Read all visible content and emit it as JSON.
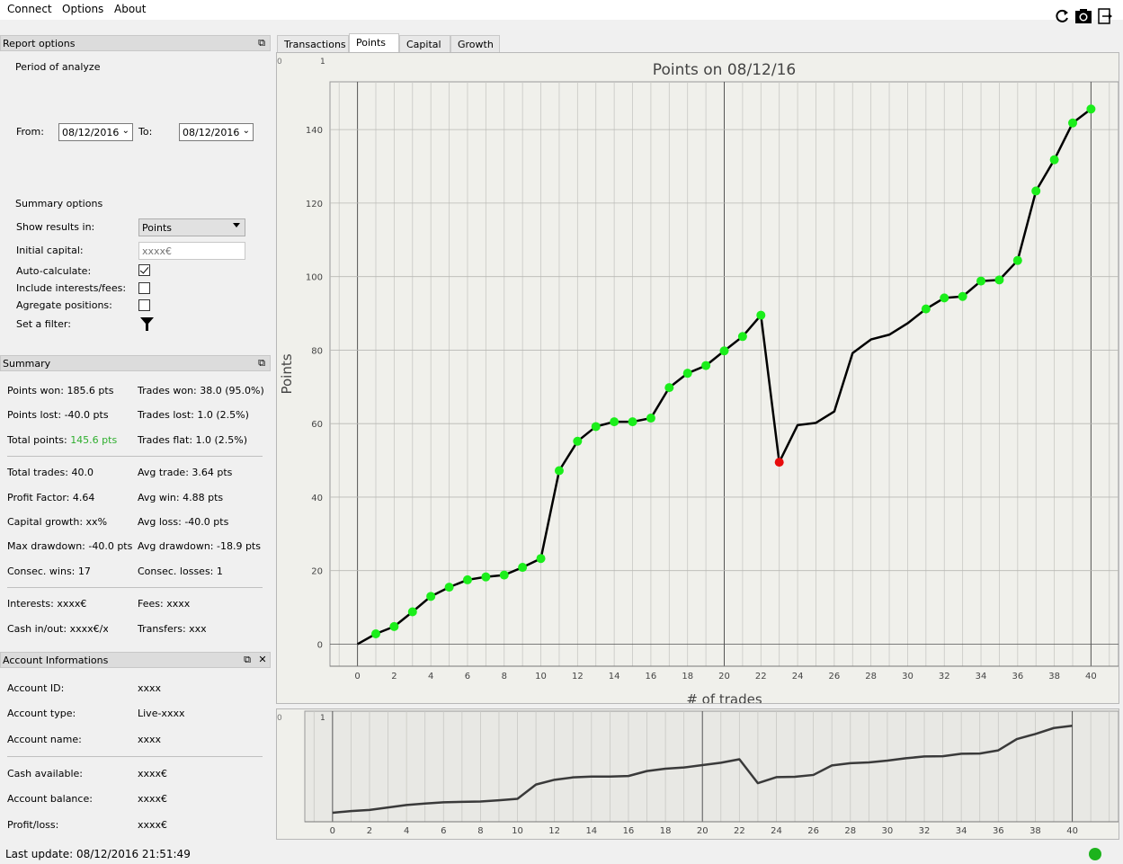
{
  "menu": {
    "connect": "Connect",
    "options": "Options",
    "about": "About"
  },
  "toolbar": {
    "icons": [
      "refresh-icon",
      "camera-icon",
      "export-icon"
    ]
  },
  "report_options": {
    "title": "Report options",
    "period_label": "Period of analyze",
    "from_label": "From:",
    "from_value": "08/12/2016",
    "to_label": "To:",
    "to_value": "08/12/2016",
    "summary_options_label": "Summary options",
    "show_results_label": "Show results in:",
    "show_results_value": "Points",
    "initial_capital_label": "Initial capital:",
    "initial_capital_placeholder": "xxxx€",
    "auto_calc_label": "Auto-calculate:",
    "auto_calc_checked": true,
    "include_fees_label": "Include interests/fees:",
    "include_fees_checked": false,
    "aggregate_label": "Agregate positions:",
    "aggregate_checked": false,
    "filter_label": "Set a filter:"
  },
  "summary": {
    "title": "Summary",
    "points_won": "Points won: 185.6 pts",
    "trades_won": "Trades won: 38.0 (95.0%)",
    "points_lost": "Points lost: -40.0 pts",
    "trades_lost": "Trades lost: 1.0 (2.5%)",
    "total_points_label": "Total points: ",
    "total_points_value": "145.6 pts",
    "total_points_color": "#2eae2e",
    "trades_flat": "Trades flat: 1.0 (2.5%)",
    "total_trades": "Total trades: 40.0",
    "avg_trade": "Avg trade: 3.64 pts",
    "profit_factor": "Profit Factor: 4.64",
    "avg_win": "Avg win: 4.88 pts",
    "capital_growth": "Capital growth: xx%",
    "avg_loss": "Avg loss: -40.0 pts",
    "max_drawdown": "Max drawdown: -40.0 pts",
    "avg_drawdown": "Avg drawdown: -18.9 pts",
    "consec_wins": "Consec. wins: 17",
    "consec_losses": "Consec. losses: 1",
    "interests": "Interests: xxxx€",
    "fees": "Fees: xxxx",
    "cash_inout": "Cash in/out: xxxx€/xx:",
    "transfers": "Transfers: xxxx"
  },
  "account": {
    "title": "Account Informations",
    "id_label": "Account ID:",
    "id_value": "xxxx",
    "type_label": "Account type:",
    "type_value": "Live-xxxx",
    "name_label": "Account name:",
    "name_value": "xxxx",
    "cash_label": "Cash available:",
    "cash_value": "xxxx€",
    "balance_label": "Account balance:",
    "balance_value": "xxxx€",
    "pl_label": "Profit/loss:",
    "pl_value": "xxxx€"
  },
  "tabs": [
    "Transactions",
    "Points",
    "Capital",
    "Growth"
  ],
  "active_tab": "Points",
  "status": {
    "last_update": "Last update: 08/12/2016 21:51:49",
    "connection_color": "#1db31d"
  },
  "chart_data": [
    {
      "type": "line",
      "title": "Points on 08/12/16",
      "xlabel": "# of trades",
      "ylabel": "Points",
      "xlim": [
        -1.5,
        41.5
      ],
      "ylim": [
        -6,
        153
      ],
      "xticks": [
        0,
        2,
        4,
        6,
        8,
        10,
        12,
        14,
        16,
        18,
        20,
        22,
        24,
        26,
        28,
        30,
        32,
        34,
        36,
        38,
        40
      ],
      "yticks": [
        0,
        20,
        40,
        60,
        80,
        100,
        120,
        140
      ],
      "vlines": [
        0,
        20,
        40
      ],
      "grid": true,
      "line_color": "#000000",
      "x": [
        0,
        1,
        2,
        3,
        4,
        5,
        6,
        7,
        8,
        9,
        10,
        11,
        12,
        13,
        14,
        15,
        16,
        17,
        18,
        19,
        20,
        21,
        22,
        23,
        24,
        25,
        26,
        27,
        28,
        29,
        30,
        31,
        32,
        33,
        34,
        35,
        36,
        37,
        38,
        39,
        40
      ],
      "y": [
        0,
        2.8,
        4.8,
        8.8,
        13,
        15.5,
        17.5,
        18.3,
        18.8,
        20.9,
        23.3,
        47.2,
        55.2,
        59.2,
        60.5,
        60.5,
        61.5,
        69.8,
        73.7,
        75.8,
        79.8,
        83.7,
        89.5,
        49.5,
        59.6,
        60.2,
        63.3,
        79.2,
        82.9,
        84.2,
        87.3,
        91.2,
        94.2,
        94.6,
        98.8,
        99.1,
        104.4,
        123.3,
        131.8,
        141.8,
        145.6
      ],
      "markers": [
        {
          "x": 1,
          "color": "#1bee1b"
        },
        {
          "x": 2,
          "color": "#1bee1b"
        },
        {
          "x": 3,
          "color": "#1bee1b"
        },
        {
          "x": 4,
          "color": "#1bee1b"
        },
        {
          "x": 5,
          "color": "#1bee1b"
        },
        {
          "x": 6,
          "color": "#1bee1b"
        },
        {
          "x": 7,
          "color": "#1bee1b"
        },
        {
          "x": 8,
          "color": "#1bee1b"
        },
        {
          "x": 9,
          "color": "#1bee1b"
        },
        {
          "x": 10,
          "color": "#1bee1b"
        },
        {
          "x": 11,
          "color": "#1bee1b"
        },
        {
          "x": 12,
          "color": "#1bee1b"
        },
        {
          "x": 13,
          "color": "#1bee1b"
        },
        {
          "x": 14,
          "color": "#1bee1b"
        },
        {
          "x": 15,
          "color": "#1bee1b"
        },
        {
          "x": 16,
          "color": "#1bee1b"
        },
        {
          "x": 17,
          "color": "#1bee1b"
        },
        {
          "x": 18,
          "color": "#1bee1b"
        },
        {
          "x": 19,
          "color": "#1bee1b"
        },
        {
          "x": 20,
          "color": "#1bee1b"
        },
        {
          "x": 21,
          "color": "#1bee1b"
        },
        {
          "x": 22,
          "color": "#1bee1b"
        },
        {
          "x": 23,
          "color": "#e80c0c"
        },
        {
          "x": 31,
          "color": "#1bee1b"
        },
        {
          "x": 32,
          "color": "#1bee1b"
        },
        {
          "x": 33,
          "color": "#1bee1b"
        },
        {
          "x": 34,
          "color": "#1bee1b"
        },
        {
          "x": 35,
          "color": "#1bee1b"
        },
        {
          "x": 36,
          "color": "#1bee1b"
        },
        {
          "x": 37,
          "color": "#1bee1b"
        },
        {
          "x": 38,
          "color": "#1bee1b"
        },
        {
          "x": 39,
          "color": "#1bee1b"
        },
        {
          "x": 40,
          "color": "#1bee1b"
        }
      ],
      "corner_labels": [
        "0",
        "1"
      ]
    },
    {
      "type": "line",
      "title": "",
      "xlim": [
        -1.5,
        42.5
      ],
      "ylim": [
        -15,
        170
      ],
      "xticks": [
        0,
        2,
        4,
        6,
        8,
        10,
        12,
        14,
        16,
        18,
        20,
        22,
        24,
        26,
        28,
        30,
        32,
        34,
        36,
        38,
        40
      ],
      "vlines": [
        0,
        20,
        40
      ],
      "line_color": "#3a3a3a",
      "x": [
        0,
        1,
        2,
        3,
        4,
        5,
        6,
        7,
        8,
        9,
        10,
        11,
        12,
        13,
        14,
        15,
        16,
        17,
        18,
        19,
        20,
        21,
        22,
        23,
        24,
        25,
        26,
        27,
        28,
        29,
        30,
        31,
        32,
        33,
        34,
        35,
        36,
        37,
        38,
        39,
        40
      ],
      "y": [
        0,
        2.8,
        4.8,
        8.8,
        13,
        15.5,
        17.5,
        18.3,
        18.8,
        20.9,
        23.3,
        47.2,
        55.2,
        59.2,
        60.5,
        60.5,
        61.5,
        69.8,
        73.7,
        75.8,
        79.8,
        83.7,
        89.5,
        49.5,
        59.6,
        60.2,
        63.3,
        79.2,
        82.9,
        84.2,
        87.3,
        91.2,
        94.2,
        94.6,
        98.8,
        99.1,
        104.4,
        123.3,
        131.8,
        141.8,
        145.6
      ],
      "corner_labels": [
        "0",
        "1"
      ]
    }
  ]
}
